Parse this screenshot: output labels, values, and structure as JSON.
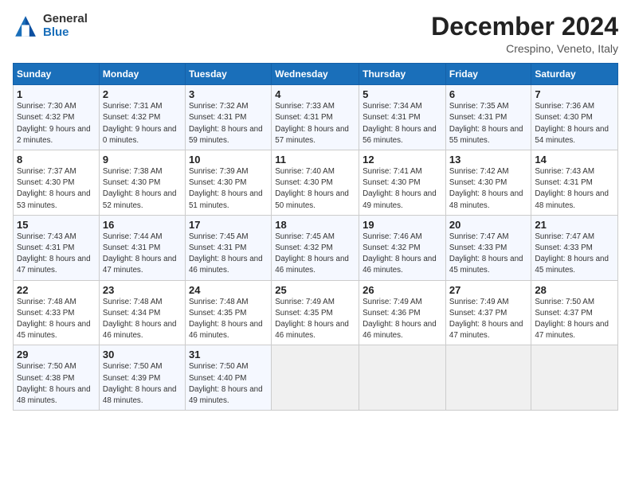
{
  "logo": {
    "general": "General",
    "blue": "Blue"
  },
  "calendar": {
    "title": "December 2024",
    "subtitle": "Crespino, Veneto, Italy",
    "headers": [
      "Sunday",
      "Monday",
      "Tuesday",
      "Wednesday",
      "Thursday",
      "Friday",
      "Saturday"
    ],
    "weeks": [
      [
        {
          "day": "1",
          "sunrise": "7:30 AM",
          "sunset": "4:32 PM",
          "daylight": "9 hours and 2 minutes."
        },
        {
          "day": "2",
          "sunrise": "7:31 AM",
          "sunset": "4:32 PM",
          "daylight": "9 hours and 0 minutes."
        },
        {
          "day": "3",
          "sunrise": "7:32 AM",
          "sunset": "4:31 PM",
          "daylight": "8 hours and 59 minutes."
        },
        {
          "day": "4",
          "sunrise": "7:33 AM",
          "sunset": "4:31 PM",
          "daylight": "8 hours and 57 minutes."
        },
        {
          "day": "5",
          "sunrise": "7:34 AM",
          "sunset": "4:31 PM",
          "daylight": "8 hours and 56 minutes."
        },
        {
          "day": "6",
          "sunrise": "7:35 AM",
          "sunset": "4:31 PM",
          "daylight": "8 hours and 55 minutes."
        },
        {
          "day": "7",
          "sunrise": "7:36 AM",
          "sunset": "4:30 PM",
          "daylight": "8 hours and 54 minutes."
        }
      ],
      [
        {
          "day": "8",
          "sunrise": "7:37 AM",
          "sunset": "4:30 PM",
          "daylight": "8 hours and 53 minutes."
        },
        {
          "day": "9",
          "sunrise": "7:38 AM",
          "sunset": "4:30 PM",
          "daylight": "8 hours and 52 minutes."
        },
        {
          "day": "10",
          "sunrise": "7:39 AM",
          "sunset": "4:30 PM",
          "daylight": "8 hours and 51 minutes."
        },
        {
          "day": "11",
          "sunrise": "7:40 AM",
          "sunset": "4:30 PM",
          "daylight": "8 hours and 50 minutes."
        },
        {
          "day": "12",
          "sunrise": "7:41 AM",
          "sunset": "4:30 PM",
          "daylight": "8 hours and 49 minutes."
        },
        {
          "day": "13",
          "sunrise": "7:42 AM",
          "sunset": "4:30 PM",
          "daylight": "8 hours and 48 minutes."
        },
        {
          "day": "14",
          "sunrise": "7:43 AM",
          "sunset": "4:31 PM",
          "daylight": "8 hours and 48 minutes."
        }
      ],
      [
        {
          "day": "15",
          "sunrise": "7:43 AM",
          "sunset": "4:31 PM",
          "daylight": "8 hours and 47 minutes."
        },
        {
          "day": "16",
          "sunrise": "7:44 AM",
          "sunset": "4:31 PM",
          "daylight": "8 hours and 47 minutes."
        },
        {
          "day": "17",
          "sunrise": "7:45 AM",
          "sunset": "4:31 PM",
          "daylight": "8 hours and 46 minutes."
        },
        {
          "day": "18",
          "sunrise": "7:45 AM",
          "sunset": "4:32 PM",
          "daylight": "8 hours and 46 minutes."
        },
        {
          "day": "19",
          "sunrise": "7:46 AM",
          "sunset": "4:32 PM",
          "daylight": "8 hours and 46 minutes."
        },
        {
          "day": "20",
          "sunrise": "7:47 AM",
          "sunset": "4:33 PM",
          "daylight": "8 hours and 45 minutes."
        },
        {
          "day": "21",
          "sunrise": "7:47 AM",
          "sunset": "4:33 PM",
          "daylight": "8 hours and 45 minutes."
        }
      ],
      [
        {
          "day": "22",
          "sunrise": "7:48 AM",
          "sunset": "4:33 PM",
          "daylight": "8 hours and 45 minutes."
        },
        {
          "day": "23",
          "sunrise": "7:48 AM",
          "sunset": "4:34 PM",
          "daylight": "8 hours and 46 minutes."
        },
        {
          "day": "24",
          "sunrise": "7:48 AM",
          "sunset": "4:35 PM",
          "daylight": "8 hours and 46 minutes."
        },
        {
          "day": "25",
          "sunrise": "7:49 AM",
          "sunset": "4:35 PM",
          "daylight": "8 hours and 46 minutes."
        },
        {
          "day": "26",
          "sunrise": "7:49 AM",
          "sunset": "4:36 PM",
          "daylight": "8 hours and 46 minutes."
        },
        {
          "day": "27",
          "sunrise": "7:49 AM",
          "sunset": "4:37 PM",
          "daylight": "8 hours and 47 minutes."
        },
        {
          "day": "28",
          "sunrise": "7:50 AM",
          "sunset": "4:37 PM",
          "daylight": "8 hours and 47 minutes."
        }
      ],
      [
        {
          "day": "29",
          "sunrise": "7:50 AM",
          "sunset": "4:38 PM",
          "daylight": "8 hours and 48 minutes."
        },
        {
          "day": "30",
          "sunrise": "7:50 AM",
          "sunset": "4:39 PM",
          "daylight": "8 hours and 48 minutes."
        },
        {
          "day": "31",
          "sunrise": "7:50 AM",
          "sunset": "4:40 PM",
          "daylight": "8 hours and 49 minutes."
        },
        null,
        null,
        null,
        null
      ]
    ]
  }
}
